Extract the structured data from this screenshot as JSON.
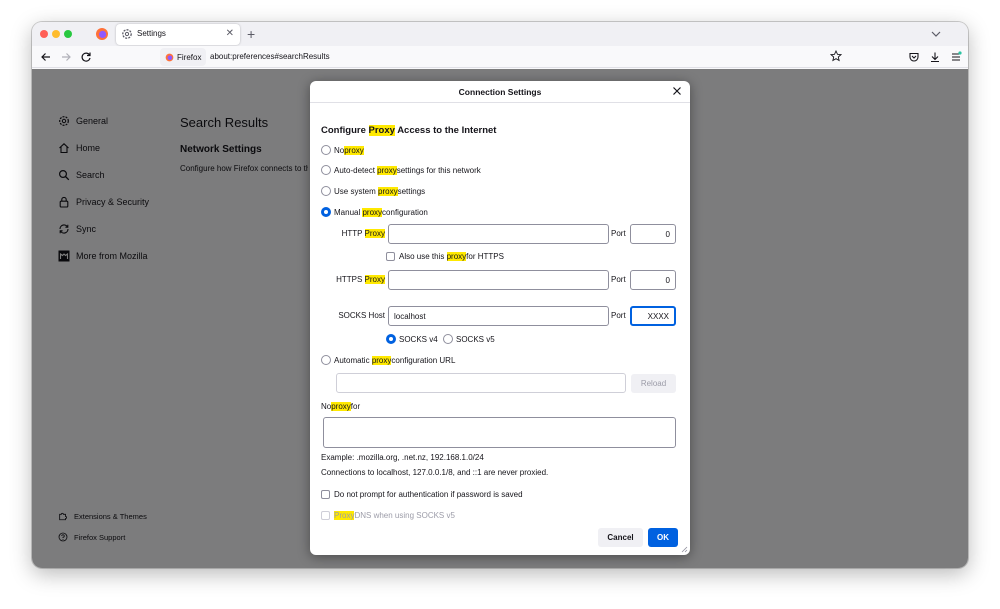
{
  "browser": {
    "tab": {
      "title": "Settings",
      "icon": "gear-icon"
    },
    "identity_label": "Firefox",
    "url": "about:preferences#searchResults"
  },
  "sidebar": {
    "items": [
      {
        "label": "General",
        "icon": "gear-icon"
      },
      {
        "label": "Home",
        "icon": "home-icon"
      },
      {
        "label": "Search",
        "icon": "search-icon"
      },
      {
        "label": "Privacy & Security",
        "icon": "lock-icon"
      },
      {
        "label": "Sync",
        "icon": "sync-icon"
      },
      {
        "label": "More from Mozilla",
        "icon": "mozilla-icon"
      }
    ],
    "footer": [
      {
        "label": "Extensions & Themes",
        "icon": "puzzle-icon"
      },
      {
        "label": "Firefox Support",
        "icon": "help-icon"
      }
    ]
  },
  "main": {
    "title": "Search Results",
    "section_title": "Network Settings",
    "section_desc": "Configure how Firefox connects to the internet."
  },
  "dialog": {
    "title": "Connection Settings",
    "heading": {
      "before": "Configure ",
      "hl": "Proxy",
      "after": " Access to the Internet"
    },
    "options": {
      "no_proxy": {
        "before": "No ",
        "hl": "proxy",
        "after": ""
      },
      "auto_detect": {
        "before": "Auto-detect ",
        "hl": "proxy",
        "after": " settings for this network"
      },
      "system": {
        "before": "Use system ",
        "hl": "proxy",
        "after": " settings"
      },
      "manual": {
        "before": "Manual ",
        "hl": "proxy",
        "after": " configuration"
      },
      "auto_url": {
        "before": "Automatic ",
        "hl": "proxy",
        "after": " configuration URL"
      }
    },
    "selected_option": "manual",
    "http": {
      "label_before": "HTTP ",
      "label_hl": "Proxy",
      "value": "",
      "port_label": "Port",
      "port": "0"
    },
    "also_https": {
      "before": "Also use this ",
      "hl": "proxy",
      "after": " for HTTPS",
      "checked": false
    },
    "https": {
      "label_before": "HTTPS ",
      "label_hl": "Proxy",
      "value": "",
      "port_label": "Port",
      "port": "0"
    },
    "socks": {
      "label": "SOCKS Host",
      "value": "localhost",
      "port_label": "Port",
      "port": "XXXX"
    },
    "socks_versions": {
      "v4": "SOCKS v4",
      "v5": "SOCKS v5",
      "selected": "v4"
    },
    "auto_url_value": "",
    "reload_label": "Reload",
    "no_proxy_for": {
      "before": "No ",
      "hl": "proxy",
      "after": " for"
    },
    "no_proxy_value": "",
    "example": "Example: .mozilla.org, .net.nz, 192.168.1.0/24",
    "never_proxied": "Connections to localhost, 127.0.0.1/8, and ::1 are never proxied.",
    "no_prompt": {
      "label": "Do not prompt for authentication if password is saved",
      "checked": false
    },
    "proxy_dns": {
      "hl": "Proxy",
      "after": " DNS when using SOCKS v5",
      "checked": false
    },
    "cancel_label": "Cancel",
    "ok_label": "OK"
  },
  "colors": {
    "accent": "#0061e0",
    "highlight": "#ffe900",
    "overlay": "rgba(0,0,0,0.5)"
  }
}
